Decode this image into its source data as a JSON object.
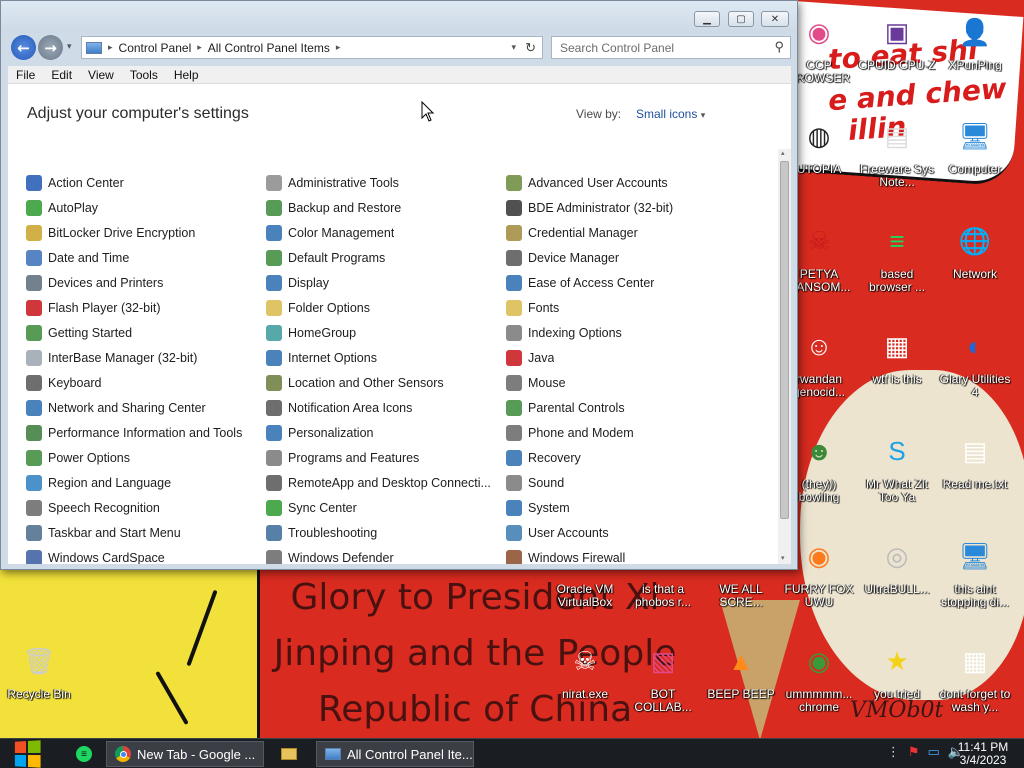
{
  "window": {
    "breadcrumb": [
      "Control Panel",
      "All Control Panel Items"
    ],
    "search_placeholder": "Search Control Panel",
    "menu": [
      "File",
      "Edit",
      "View",
      "Tools",
      "Help"
    ],
    "page_title": "Adjust your computer's settings",
    "view_by_label": "View by:",
    "view_by_value": "Small icons",
    "columns": [
      [
        {
          "label": "Action Center",
          "icon": "flag-icon",
          "color": "#1f57b3"
        },
        {
          "label": "AutoPlay",
          "icon": "autoplay-icon",
          "color": "#2e9a2e"
        },
        {
          "label": "BitLocker Drive Encryption",
          "icon": "bitlocker-icon",
          "color": "#c9a227"
        },
        {
          "label": "Date and Time",
          "icon": "clock-icon",
          "color": "#3a6fb8"
        },
        {
          "label": "Devices and Printers",
          "icon": "printer-icon",
          "color": "#5a6a7a"
        },
        {
          "label": "Flash Player (32-bit)",
          "icon": "flash-icon",
          "color": "#c8141a"
        },
        {
          "label": "Getting Started",
          "icon": "getting-started-icon",
          "color": "#3a8a3a"
        },
        {
          "label": "InterBase Manager (32-bit)",
          "icon": "interbase-icon",
          "color": "#9aa4ae"
        },
        {
          "label": "Keyboard",
          "icon": "keyboard-icon",
          "color": "#555555"
        },
        {
          "label": "Network and Sharing Center",
          "icon": "network-icon",
          "color": "#2a6cb0"
        },
        {
          "label": "Performance Information and Tools",
          "icon": "performance-icon",
          "color": "#3a7a3a"
        },
        {
          "label": "Power Options",
          "icon": "power-icon",
          "color": "#3a8a3a"
        },
        {
          "label": "Region and Language",
          "icon": "globe-icon",
          "color": "#2d7fc0"
        },
        {
          "label": "Speech Recognition",
          "icon": "microphone-icon",
          "color": "#666666"
        },
        {
          "label": "Taskbar and Start Menu",
          "icon": "taskbar-icon",
          "color": "#4a6a8a"
        },
        {
          "label": "Windows CardSpace",
          "icon": "cardspace-icon",
          "color": "#3a5aa0"
        }
      ],
      [
        {
          "label": "Administrative Tools",
          "icon": "admin-tools-icon",
          "color": "#8a8a8a"
        },
        {
          "label": "Backup and Restore",
          "icon": "backup-icon",
          "color": "#3a8a3a"
        },
        {
          "label": "Color Management",
          "icon": "color-management-icon",
          "color": "#2a6cb0"
        },
        {
          "label": "Default Programs",
          "icon": "default-programs-icon",
          "color": "#3a8a3a"
        },
        {
          "label": "Display",
          "icon": "display-icon",
          "color": "#2a6cb0"
        },
        {
          "label": "Folder Options",
          "icon": "folder-icon",
          "color": "#d9b84a"
        },
        {
          "label": "HomeGroup",
          "icon": "homegroup-icon",
          "color": "#3a9a9a"
        },
        {
          "label": "Internet Options",
          "icon": "internet-options-icon",
          "color": "#2a6cb0"
        },
        {
          "label": "Location and Other Sensors",
          "icon": "sensors-icon",
          "color": "#6a7a3a"
        },
        {
          "label": "Notification Area Icons",
          "icon": "notification-icon",
          "color": "#555555"
        },
        {
          "label": "Personalization",
          "icon": "personalization-icon",
          "color": "#2a6cb0"
        },
        {
          "label": "Programs and Features",
          "icon": "programs-icon",
          "color": "#777777"
        },
        {
          "label": "RemoteApp and Desktop Connecti...",
          "icon": "remoteapp-icon",
          "color": "#555555"
        },
        {
          "label": "Sync Center",
          "icon": "sync-icon",
          "color": "#2e9a2e"
        },
        {
          "label": "Troubleshooting",
          "icon": "troubleshooting-icon",
          "color": "#3a6a9a"
        },
        {
          "label": "Windows Defender",
          "icon": "defender-icon",
          "color": "#666666"
        }
      ],
      [
        {
          "label": "Advanced User Accounts",
          "icon": "users-icon",
          "color": "#6a8a3a"
        },
        {
          "label": "BDE Administrator (32-bit)",
          "icon": "bde-icon",
          "color": "#333333"
        },
        {
          "label": "Credential Manager",
          "icon": "credential-icon",
          "color": "#a08a3a"
        },
        {
          "label": "Device Manager",
          "icon": "device-manager-icon",
          "color": "#555555"
        },
        {
          "label": "Ease of Access Center",
          "icon": "ease-of-access-icon",
          "color": "#2a6cb0"
        },
        {
          "label": "Fonts",
          "icon": "fonts-icon",
          "color": "#d9b84a"
        },
        {
          "label": "Indexing Options",
          "icon": "indexing-icon",
          "color": "#777777"
        },
        {
          "label": "Java",
          "icon": "java-icon",
          "color": "#c8141a"
        },
        {
          "label": "Mouse",
          "icon": "mouse-icon",
          "color": "#666666"
        },
        {
          "label": "Parental Controls",
          "icon": "parental-icon",
          "color": "#3a8a3a"
        },
        {
          "label": "Phone and Modem",
          "icon": "phone-icon",
          "color": "#666666"
        },
        {
          "label": "Recovery",
          "icon": "recovery-icon",
          "color": "#2a6cb0"
        },
        {
          "label": "Sound",
          "icon": "sound-icon",
          "color": "#777777"
        },
        {
          "label": "System",
          "icon": "system-icon",
          "color": "#2a6cb0"
        },
        {
          "label": "User Accounts",
          "icon": "user-icon",
          "color": "#3a7ab0"
        },
        {
          "label": "Windows Firewall",
          "icon": "firewall-icon",
          "color": "#8a4a2a"
        }
      ]
    ]
  },
  "desktop": {
    "wallpaper_text": {
      "top_lines": [
        "to eat shi",
        "e and chew",
        "illin"
      ],
      "glory_lines": [
        "Glory to President Xi",
        "Jinping and the People",
        "Republic of China"
      ],
      "signature": "VMOb0t"
    },
    "icons": [
      {
        "label": "CCP BROWSER",
        "glyph": "◉",
        "color": "#e24a8a"
      },
      {
        "label": "CPUID CPU-Z",
        "glyph": "▣",
        "color": "#6a3a9a"
      },
      {
        "label": "XPunPing",
        "glyph": "👤",
        "color": "#d9b84a"
      },
      {
        "label": "UTOPIA",
        "glyph": "◍",
        "color": "#222222"
      },
      {
        "label": "Freeware Sys Note...",
        "glyph": "▤",
        "color": "#dddddd"
      },
      {
        "label": "Computer",
        "glyph": "🖥",
        "color": "#2a8ad9"
      },
      {
        "label": "PETYA RANSOM...",
        "glyph": "☠",
        "color": "#c81a1a"
      },
      {
        "label": "based browser ...",
        "glyph": "≡",
        "color": "#1ed760"
      },
      {
        "label": "Network",
        "glyph": "🌐",
        "color": "#2a8ad9"
      },
      {
        "label": "rwandan genocid...",
        "glyph": "☺",
        "color": "#ffffff"
      },
      {
        "label": "wtf is this",
        "glyph": "▦",
        "color": "#ffffff"
      },
      {
        "label": "Glary Utilities 4",
        "glyph": "◐",
        "color": "#1a6ad9"
      },
      {
        "label": "(they)) bowling",
        "glyph": "☻",
        "color": "#3a8a3a"
      },
      {
        "label": "Mr What Zit Too Ya",
        "glyph": "S",
        "color": "#1aa3e6"
      },
      {
        "label": "Read me.txt",
        "glyph": "▤",
        "color": "#ffffff"
      },
      {
        "label": "Oracle VM VirtualBox",
        "glyph": "▢",
        "color": "#3a6ab0"
      },
      {
        "label": "is that a phobos r...",
        "glyph": "◌",
        "color": "#aaaaaa"
      },
      {
        "label": "WE ALL SCRE...",
        "glyph": "◌",
        "color": "#aaaaaa"
      },
      {
        "label": "FURRY FOX UWU",
        "glyph": "◉",
        "color": "#ff7a1a"
      },
      {
        "label": "UltraBULL...",
        "glyph": "◎",
        "color": "#bbbbbb"
      },
      {
        "label": "this aint stopping di...",
        "glyph": "🖥",
        "color": "#2a8ad9"
      },
      {
        "label": "Recycle Bin",
        "glyph": "🗑",
        "color": "#cccccc"
      },
      {
        "label": "nirat.exe",
        "glyph": "☠",
        "color": "#ffffff"
      },
      {
        "label": "BOT COLLAB...",
        "glyph": "▧",
        "color": "#e24a8a"
      },
      {
        "label": "BEEP BEEP",
        "glyph": "▲",
        "color": "#ff8a1a"
      },
      {
        "label": "ummmmm... chrome",
        "glyph": "◉",
        "color": "#3a9a3a"
      },
      {
        "label": "you tried",
        "glyph": "★",
        "color": "#f5d21a"
      },
      {
        "label": "dont forget to wash y...",
        "glyph": "▦",
        "color": "#ffffff"
      }
    ]
  },
  "taskbar": {
    "buttons": [
      {
        "label": "",
        "icon": "spotify-icon"
      },
      {
        "label": "New Tab - Google ...",
        "icon": "chrome-icon"
      },
      {
        "label": "",
        "icon": "explorer-icon"
      },
      {
        "label": "All Control Panel Ite...",
        "icon": "control-panel-icon"
      }
    ],
    "time": "11:41 PM",
    "date": "3/4/2023"
  }
}
